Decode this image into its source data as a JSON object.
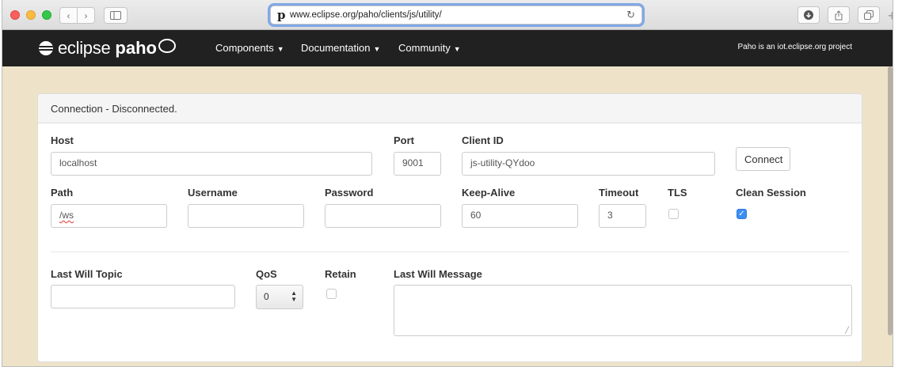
{
  "browser": {
    "url": "www.eclipse.org/paho/clients/js/utility/",
    "favicon": "p",
    "icons": [
      "back-icon",
      "forward-icon",
      "sidebar-icon",
      "reload-icon",
      "download-icon",
      "share-icon",
      "tabs-icon",
      "new-tab-icon"
    ]
  },
  "header": {
    "logo_eclipse": "eclipse",
    "logo_paho": "paho",
    "nav": [
      {
        "label": "Components"
      },
      {
        "label": "Documentation"
      },
      {
        "label": "Community"
      }
    ],
    "tagline": "Paho is an iot.eclipse.org project"
  },
  "panel": {
    "heading": "Connection - Disconnected."
  },
  "connection": {
    "host": {
      "label": "Host",
      "value": "localhost"
    },
    "port": {
      "label": "Port",
      "value": "9001"
    },
    "client_id": {
      "label": "Client ID",
      "value": "js-utility-QYdoo"
    },
    "connect_label": "Connect",
    "path": {
      "label": "Path",
      "value": "/ws"
    },
    "username": {
      "label": "Username",
      "value": ""
    },
    "password": {
      "label": "Password",
      "value": ""
    },
    "keep_alive": {
      "label": "Keep-Alive",
      "value": "60"
    },
    "timeout": {
      "label": "Timeout",
      "value": "3"
    },
    "tls": {
      "label": "TLS",
      "checked": false
    },
    "clean_session": {
      "label": "Clean Session",
      "checked": true
    }
  },
  "last_will": {
    "topic": {
      "label": "Last Will Topic",
      "value": ""
    },
    "qos": {
      "label": "QoS",
      "value": "0"
    },
    "retain": {
      "label": "Retain",
      "checked": false
    },
    "message": {
      "label": "Last Will Message",
      "value": ""
    }
  },
  "colors": {
    "page_background": "#eee3c9",
    "header_background": "#212121",
    "checkbox_checked": "#3b8ef2"
  }
}
